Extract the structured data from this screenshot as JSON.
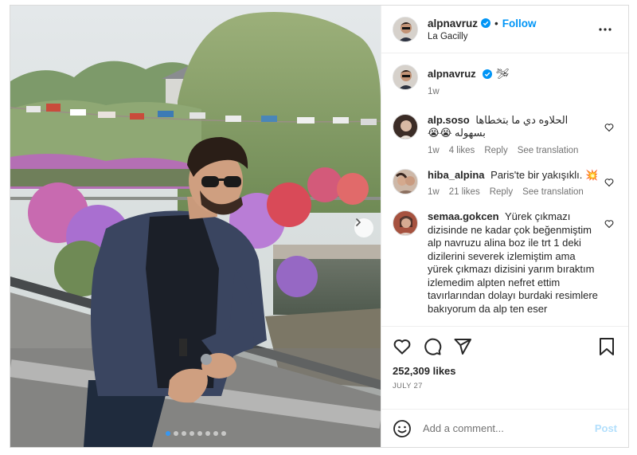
{
  "post": {
    "username": "alpnavruz",
    "follow_label": "Follow",
    "separator": "•",
    "location": "La Gacilly",
    "caption_time": "1w",
    "caption_emoji": "🛩",
    "likes": "252,309 likes",
    "date": "JULY 27"
  },
  "comments": [
    {
      "username": "alp.soso",
      "text": "الحلاوه دي ما بتخطاها بسهوله 😭😭",
      "time": "1w",
      "likes": "4 likes",
      "reply": "Reply",
      "translate": "See translation"
    },
    {
      "username": "hiba_alpina",
      "text": "Paris'te bir yakışıklı. 💥",
      "time": "1w",
      "likes": "21 likes",
      "reply": "Reply",
      "translate": "See translation"
    },
    {
      "username": "semaa.gokcen",
      "text": "Yürek çıkmazı dizisinde ne kadar çok beğenmiştim alp navruzu alina boz ile trt 1 deki dizilerini severek izlemiştim ama yürek çıkmazı dizisini yarım bıraktım izlemedim alpten nefret ettim tavırlarından dolayı burdaki resimlere bakıyorum da alp ten eser"
    }
  ],
  "add_comment": {
    "placeholder": "Add a comment...",
    "post_label": "Post"
  },
  "carousel": {
    "total": 8,
    "active": 1
  },
  "colors": {
    "accent": "#0095f6",
    "verified": "#0095f6",
    "muted": "#737373"
  },
  "icons": [
    "verified-badge-icon",
    "more-options-icon",
    "heart-icon",
    "comment-icon",
    "share-icon",
    "bookmark-icon",
    "emoji-icon",
    "chevron-right-icon"
  ]
}
